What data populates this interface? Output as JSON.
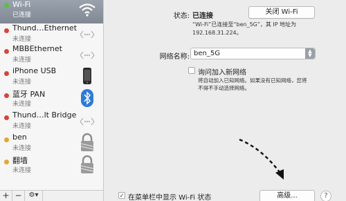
{
  "sidebar": {
    "services": [
      {
        "name": "Wi-Fi",
        "status": "已连接",
        "dot": "#5bbf3f",
        "icon": "wifi-icon"
      },
      {
        "name": "Thund…Ethernet",
        "status": "未连接",
        "dot": "#d9433a",
        "icon": "ethernet-icon"
      },
      {
        "name": "MBBEthernet",
        "status": "未连接",
        "dot": "#d9433a",
        "icon": "ethernet-icon"
      },
      {
        "name": "iPhone USB",
        "status": "未连接",
        "dot": "#d9433a",
        "icon": "iphone-icon"
      },
      {
        "name": "蓝牙 PAN",
        "status": "未连接",
        "dot": "#d9433a",
        "icon": "bluetooth-icon"
      },
      {
        "name": "Thund…lt Bridge",
        "status": "未连接",
        "dot": "#d9433a",
        "icon": "ethernet-icon"
      },
      {
        "name": "ben",
        "status": "未连接",
        "dot": "#e3a72f",
        "icon": "lock-icon"
      },
      {
        "name": "翻墙",
        "status": "未连接",
        "dot": "#e3a72f",
        "icon": "lock-icon"
      }
    ],
    "bottom": {
      "add": "+",
      "remove": "−",
      "gear": "⚙▾"
    }
  },
  "detail": {
    "status_label": "状态:",
    "status_value": "已连接",
    "wifi_toggle_button": "关闭 Wi-Fi",
    "status_desc_line1": "“Wi-Fi”已连接至“ben_5G”，其 IP 地址为",
    "status_desc_line2": "192.168.31.224。",
    "network_name_label": "网络名称:",
    "network_name_value": "ben_5G",
    "ask_join_label": "询问加入新网络",
    "ask_join_desc_line1": "将自动加入已知网络。如果没有已知网络，您将",
    "ask_join_desc_line2": "不得不手动选择网络。",
    "menubar_checkbox_label": "在菜单栏中显示 Wi-Fi 状态",
    "advanced_button": "高级...",
    "help_button": "?"
  },
  "colors": {
    "accent": "#1d8ef1",
    "connected": "#5bbf3f",
    "disconnected": "#d9433a",
    "vpn": "#e3a72f"
  }
}
